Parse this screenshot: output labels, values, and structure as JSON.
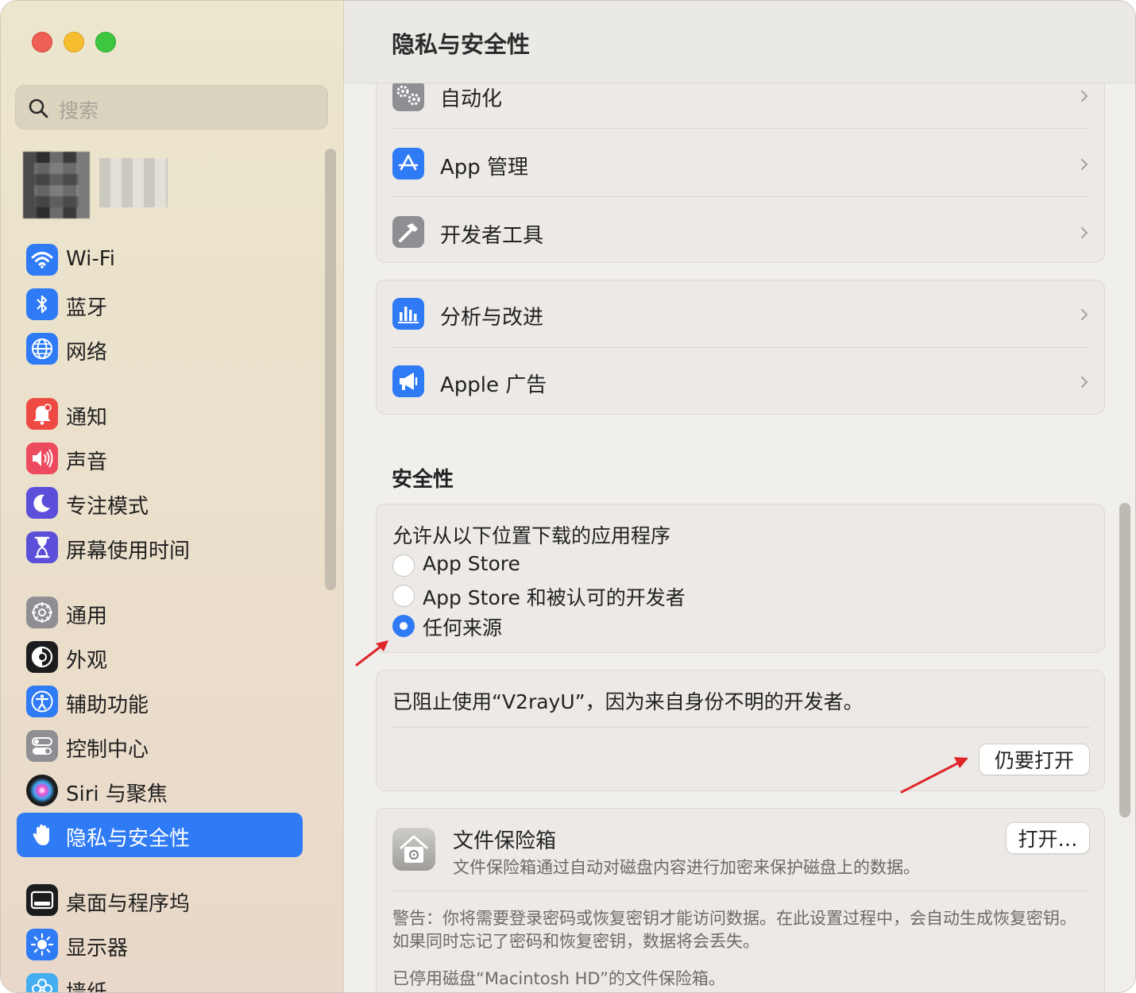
{
  "window": {
    "title": "隐私与安全性"
  },
  "sidebar": {
    "search_placeholder": "搜索",
    "items": [
      {
        "label": "Wi-Fi",
        "icon": "wifi-icon",
        "color": "#2f7bf5"
      },
      {
        "label": "蓝牙",
        "icon": "bluetooth-icon",
        "color": "#2f7bf5"
      },
      {
        "label": "网络",
        "icon": "globe-icon",
        "color": "#2f7bf5"
      },
      {
        "label": "通知",
        "icon": "bell-icon",
        "color": "#ee4a43"
      },
      {
        "label": "声音",
        "icon": "speaker-icon",
        "color": "#ee4a5f"
      },
      {
        "label": "专注模式",
        "icon": "moon-icon",
        "color": "#5b4fd9"
      },
      {
        "label": "屏幕使用时间",
        "icon": "hourglass-icon",
        "color": "#5b4fd9"
      },
      {
        "label": "通用",
        "icon": "gear-icon",
        "color": "#8e8e93"
      },
      {
        "label": "外观",
        "icon": "appearance-icon",
        "color": "#1c1c1e"
      },
      {
        "label": "辅助功能",
        "icon": "accessibility-icon",
        "color": "#2f7bf5"
      },
      {
        "label": "控制中心",
        "icon": "toggles-icon",
        "color": "#8e8e93"
      },
      {
        "label": "Siri 与聚焦",
        "icon": "siri-icon",
        "color": "#1c1c1e"
      },
      {
        "label": "隐私与安全性",
        "icon": "hand-icon",
        "color": "#2f7bf5",
        "active": true
      },
      {
        "label": "桌面与程序坞",
        "icon": "dock-icon",
        "color": "#1c1c1e"
      },
      {
        "label": "显示器",
        "icon": "sun-icon",
        "color": "#2f7bf5"
      },
      {
        "label": "墙纸",
        "icon": "flower-icon",
        "color": "#45aef0"
      }
    ]
  },
  "main": {
    "group1": [
      {
        "label": "自动化",
        "icon": "automation-gears-icon",
        "color": "#8e8e93"
      },
      {
        "label": "App 管理",
        "icon": "app-store-icon",
        "color": "#2f7bf5"
      },
      {
        "label": "开发者工具",
        "icon": "hammer-icon",
        "color": "#8e8e93"
      }
    ],
    "group2": [
      {
        "label": "分析与改进",
        "icon": "bar-chart-icon",
        "color": "#2f7bf5"
      },
      {
        "label": "Apple 广告",
        "icon": "megaphone-icon",
        "color": "#2f7bf5"
      }
    ],
    "security": {
      "title": "安全性",
      "allow_label": "允许从以下位置下载的应用程序",
      "options": [
        "App Store",
        "App Store 和被认可的开发者",
        "任何来源"
      ],
      "selected_index": 2,
      "blocked_message": "已阻止使用“V2rayU”，因为来自身份不明的开发者。",
      "open_anyway": "仍要打开"
    },
    "filevault": {
      "title": "文件保险箱",
      "description": "文件保险箱通过自动对磁盘内容进行加密来保护磁盘上的数据。",
      "open_button": "打开…",
      "warning": "警告：你将需要登录密码或恢复密钥才能访问数据。在此设置过程中，会自动生成恢复密钥。如果同时忘记了密码和恢复密钥，数据将会丢失。",
      "status": "已停用磁盘“Macintosh HD”的文件保险箱。"
    }
  },
  "colors": {
    "accent": "#2f7bf5",
    "arrow": "#e0262a"
  }
}
